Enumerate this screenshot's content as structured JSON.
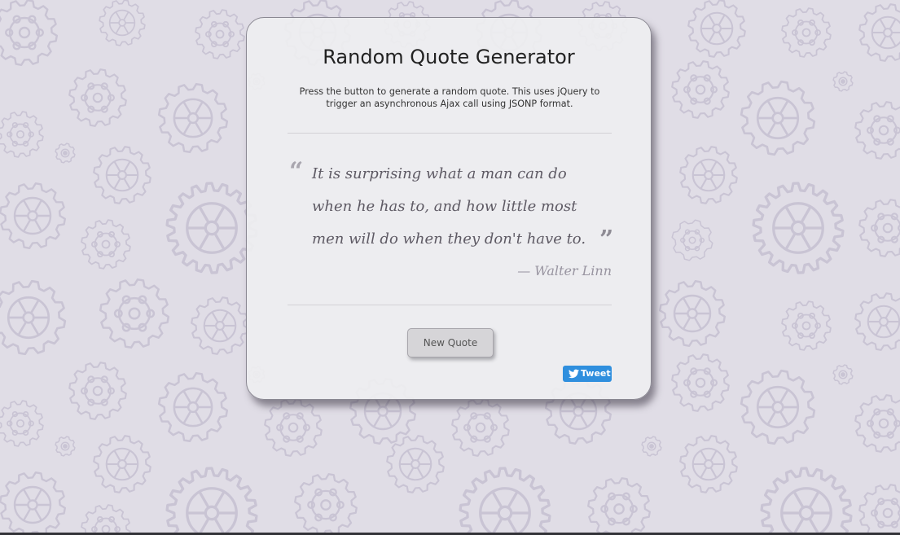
{
  "app": {
    "title": "Random Quote Generator",
    "description": "Press the button to generate a random quote. This uses jQuery to trigger an asynchronous Ajax call using JSONP format."
  },
  "quote": {
    "open_mark": "“",
    "text": "It is surprising what a man can do when he has to, and how little most men will do when they don't have to.",
    "close_mark": "”",
    "author": "— Walter Linn"
  },
  "buttons": {
    "new_quote_label": "New Quote",
    "tweet_label": "Tweet"
  },
  "icons": {
    "tweet": "twitter-bird-icon"
  },
  "colors": {
    "background": "#e0dde6",
    "gear_pattern": "#c9c4d4",
    "card": "#eeeef0",
    "tweet_button": "#2f8fde",
    "quote_text": "#5e5a64"
  }
}
